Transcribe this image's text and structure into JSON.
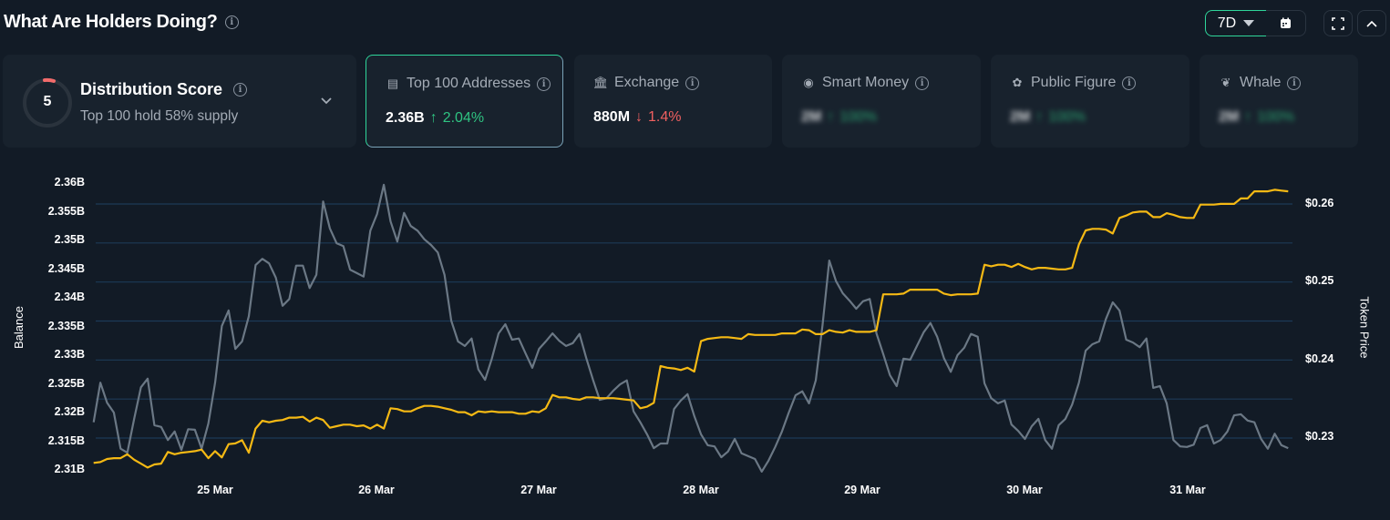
{
  "header": {
    "title": "What Are Holders Doing?",
    "range": "7D"
  },
  "distribution": {
    "score": "5",
    "label": "Distribution Score",
    "subtitle": "Top 100 hold 58% supply",
    "score_color": "#f26b6b"
  },
  "cards": [
    {
      "icon": "money-icon",
      "label": "Top 100 Addresses",
      "value": "2.36B",
      "change": "2.04%",
      "direction": "up",
      "selected": true
    },
    {
      "icon": "bank-icon",
      "label": "Exchange",
      "value": "880M",
      "change": "1.4%",
      "direction": "down"
    },
    {
      "icon": "sunglasses-icon",
      "label": "Smart Money",
      "value": "2M",
      "change": "100%",
      "direction": "up",
      "blurred": true
    },
    {
      "icon": "person-icon",
      "label": "Public Figure",
      "value": "2M",
      "change": "100%",
      "direction": "up",
      "blurred": true
    },
    {
      "icon": "whale-icon",
      "label": "Whale",
      "value": "2M",
      "change": "100%",
      "direction": "up",
      "blurred": true
    }
  ],
  "colors": {
    "accent": "#2fd59a",
    "up": "#2fc482",
    "down": "#f06060",
    "balance_line": "#6b7885",
    "price_line": "#f5b914",
    "grid": "#1c3a57"
  },
  "chart_data": {
    "type": "line",
    "ylabel": "Balance",
    "y2label": "Token Price",
    "ylim": [
      2.31,
      2.36
    ],
    "y2lim": [
      0.23,
      0.26
    ],
    "yticks": [
      "2.36B",
      "2.355B",
      "2.35B",
      "2.345B",
      "2.34B",
      "2.335B",
      "2.33B",
      "2.325B",
      "2.32B",
      "2.315B",
      "2.31B"
    ],
    "y2ticks": [
      "$0.26",
      "$0.25",
      "$0.24",
      "$0.23"
    ],
    "xticks": [
      "25 Mar",
      "26 Mar",
      "27 Mar",
      "28 Mar",
      "29 Mar",
      "30 Mar",
      "31 Mar"
    ],
    "grid": true,
    "series": [
      {
        "name": "Balance",
        "axis": "left"
      },
      {
        "name": "Token Price",
        "axis": "right"
      }
    ],
    "rows": [
      [
        "24 Mar 06:00",
        2.3183,
        0.2267
      ],
      [
        "24 Mar 07:00",
        2.3252,
        0.2268
      ],
      [
        "24 Mar 08:00",
        2.3217,
        0.2272
      ],
      [
        "24 Mar 09:00",
        2.32,
        0.2273
      ],
      [
        "24 Mar 10:00",
        2.3137,
        0.2273
      ],
      [
        "24 Mar 11:00",
        2.313,
        0.2278
      ],
      [
        "24 Mar 12:00",
        2.3189,
        0.2271
      ],
      [
        "24 Mar 13:00",
        2.3244,
        0.2266
      ],
      [
        "24 Mar 14:00",
        2.3259,
        0.2261
      ],
      [
        "24 Mar 15:00",
        2.3178,
        0.2265
      ],
      [
        "24 Mar 16:00",
        2.3175,
        0.2266
      ],
      [
        "24 Mar 17:00",
        2.3152,
        0.2281
      ],
      [
        "24 Mar 18:00",
        2.3167,
        0.2278
      ],
      [
        "24 Mar 19:00",
        2.3135,
        0.228
      ],
      [
        "24 Mar 20:00",
        2.3171,
        0.2281
      ],
      [
        "24 Mar 21:00",
        2.317,
        0.2282
      ],
      [
        "24 Mar 22:00",
        2.3137,
        0.2284
      ],
      [
        "24 Mar 23:00",
        2.3181,
        0.2273
      ],
      [
        "25 Mar 00:00",
        2.3252,
        0.2282
      ],
      [
        "25 Mar 01:00",
        2.3351,
        0.2274
      ],
      [
        "25 Mar 02:00",
        2.3378,
        0.2291
      ],
      [
        "25 Mar 03:00",
        2.3311,
        0.2292
      ],
      [
        "25 Mar 04:00",
        2.3324,
        0.2296
      ],
      [
        "25 Mar 05:00",
        2.3368,
        0.228
      ],
      [
        "25 Mar 06:00",
        2.3457,
        0.2311
      ],
      [
        "25 Mar 07:00",
        2.3468,
        0.2321
      ],
      [
        "25 Mar 08:00",
        2.346,
        0.2319
      ],
      [
        "25 Mar 09:00",
        2.3435,
        0.2321
      ],
      [
        "25 Mar 10:00",
        2.3386,
        0.2322
      ],
      [
        "25 Mar 11:00",
        2.3398,
        0.2325
      ],
      [
        "25 Mar 12:00",
        2.3456,
        0.2325
      ],
      [
        "25 Mar 13:00",
        2.3456,
        0.2326
      ],
      [
        "25 Mar 14:00",
        2.3417,
        0.232
      ],
      [
        "25 Mar 15:00",
        2.344,
        0.2325
      ],
      [
        "25 Mar 16:00",
        2.3568,
        0.2322
      ],
      [
        "25 Mar 17:00",
        2.3521,
        0.2312
      ],
      [
        "25 Mar 18:00",
        2.3495,
        0.2314
      ],
      [
        "25 Mar 19:00",
        2.349,
        0.2316
      ],
      [
        "25 Mar 20:00",
        2.3449,
        0.2316
      ],
      [
        "25 Mar 21:00",
        2.3443,
        0.2314
      ],
      [
        "25 Mar 22:00",
        2.3437,
        0.2315
      ],
      [
        "25 Mar 23:00",
        2.3517,
        0.2311
      ],
      [
        "26 Mar 00:00",
        2.3546,
        0.2316
      ],
      [
        "26 Mar 01:00",
        2.3597,
        0.2311
      ],
      [
        "26 Mar 02:00",
        2.3533,
        0.2337
      ],
      [
        "26 Mar 03:00",
        2.3498,
        0.2336
      ],
      [
        "26 Mar 04:00",
        2.3548,
        0.2333
      ],
      [
        "26 Mar 05:00",
        2.3525,
        0.2333
      ],
      [
        "26 Mar 06:00",
        2.3517,
        0.2337
      ],
      [
        "26 Mar 07:00",
        2.3502,
        0.234
      ],
      [
        "26 Mar 08:00",
        2.3492,
        0.234
      ],
      [
        "26 Mar 09:00",
        2.3479,
        0.2339
      ],
      [
        "26 Mar 10:00",
        2.344,
        0.2337
      ],
      [
        "26 Mar 11:00",
        2.336,
        0.2335
      ],
      [
        "26 Mar 12:00",
        2.3324,
        0.2332
      ],
      [
        "26 Mar 13:00",
        2.3316,
        0.2332
      ],
      [
        "26 Mar 14:00",
        2.3329,
        0.2328
      ],
      [
        "26 Mar 15:00",
        2.3275,
        0.2333
      ],
      [
        "26 Mar 16:00",
        2.3257,
        0.2332
      ],
      [
        "26 Mar 17:00",
        2.3294,
        0.2333
      ],
      [
        "26 Mar 18:00",
        2.3338,
        0.2332
      ],
      [
        "26 Mar 19:00",
        2.3354,
        0.2332
      ],
      [
        "26 Mar 20:00",
        2.3327,
        0.2332
      ],
      [
        "26 Mar 21:00",
        2.3329,
        0.233
      ],
      [
        "26 Mar 22:00",
        2.3303,
        0.233
      ],
      [
        "26 Mar 23:00",
        2.3278,
        0.2333
      ],
      [
        "27 Mar 00:00",
        2.3311,
        0.2332
      ],
      [
        "27 Mar 01:00",
        2.3324,
        0.2337
      ],
      [
        "27 Mar 02:00",
        2.3338,
        0.2354
      ],
      [
        "27 Mar 03:00",
        2.3325,
        0.2351
      ],
      [
        "27 Mar 04:00",
        2.3316,
        0.2351
      ],
      [
        "27 Mar 05:00",
        2.3321,
        0.2349
      ],
      [
        "27 Mar 06:00",
        2.3337,
        0.2348
      ],
      [
        "27 Mar 07:00",
        2.3295,
        0.2351
      ],
      [
        "27 Mar 08:00",
        2.3257,
        0.2351
      ],
      [
        "27 Mar 09:00",
        2.3222,
        0.235
      ],
      [
        "27 Mar 10:00",
        2.3225,
        0.235
      ],
      [
        "27 Mar 11:00",
        2.3238,
        0.235
      ],
      [
        "27 Mar 12:00",
        2.3249,
        0.2349
      ],
      [
        "27 Mar 13:00",
        2.3256,
        0.2348
      ],
      [
        "27 Mar 14:00",
        2.3202,
        0.2347
      ],
      [
        "27 Mar 15:00",
        2.3183,
        0.2337
      ],
      [
        "27 Mar 16:00",
        2.3162,
        0.2339
      ],
      [
        "27 Mar 17:00",
        2.3138,
        0.2344
      ],
      [
        "27 Mar 18:00",
        2.3146,
        0.2391
      ],
      [
        "27 Mar 19:00",
        2.3146,
        0.2389
      ],
      [
        "27 Mar 20:00",
        2.3206,
        0.2388
      ],
      [
        "27 Mar 21:00",
        2.3221,
        0.2386
      ],
      [
        "27 Mar 22:00",
        2.3232,
        0.2389
      ],
      [
        "27 Mar 23:00",
        2.3194,
        0.2384
      ],
      [
        "28 Mar 00:00",
        2.3162,
        0.2423
      ],
      [
        "28 Mar 01:00",
        2.3143,
        0.2426
      ],
      [
        "28 Mar 02:00",
        2.3141,
        0.2427
      ],
      [
        "28 Mar 03:00",
        2.3122,
        0.2428
      ],
      [
        "28 Mar 04:00",
        2.3132,
        0.2428
      ],
      [
        "28 Mar 05:00",
        2.3154,
        0.2427
      ],
      [
        "28 Mar 06:00",
        2.3129,
        0.2426
      ],
      [
        "28 Mar 07:00",
        2.3124,
        0.2432
      ],
      [
        "28 Mar 08:00",
        2.3119,
        0.2431
      ],
      [
        "28 Mar 09:00",
        2.3097,
        0.2431
      ],
      [
        "28 Mar 10:00",
        2.3116,
        0.2431
      ],
      [
        "28 Mar 11:00",
        2.314,
        0.2431
      ],
      [
        "28 Mar 12:00",
        2.3167,
        0.2433
      ],
      [
        "28 Mar 13:00",
        2.32,
        0.2433
      ],
      [
        "28 Mar 14:00",
        2.323,
        0.2433
      ],
      [
        "28 Mar 15:00",
        2.3237,
        0.2438
      ],
      [
        "28 Mar 16:00",
        2.3216,
        0.2437
      ],
      [
        "28 Mar 17:00",
        2.3256,
        0.2432
      ],
      [
        "28 Mar 18:00",
        2.3352,
        0.2432
      ],
      [
        "28 Mar 19:00",
        2.3465,
        0.2437
      ],
      [
        "28 Mar 20:00",
        2.3429,
        0.2435
      ],
      [
        "28 Mar 21:00",
        2.3408,
        0.2434
      ],
      [
        "28 Mar 22:00",
        2.3395,
        0.2437
      ],
      [
        "28 Mar 23:00",
        2.3381,
        0.2435
      ],
      [
        "29 Mar 00:00",
        2.3394,
        0.2435
      ],
      [
        "29 Mar 01:00",
        2.3398,
        0.2435
      ],
      [
        "29 Mar 02:00",
        2.3338,
        0.2437
      ],
      [
        "29 Mar 03:00",
        2.3302,
        0.2483
      ],
      [
        "29 Mar 04:00",
        2.3265,
        0.2483
      ],
      [
        "29 Mar 05:00",
        2.3246,
        0.2483
      ],
      [
        "29 Mar 06:00",
        2.3294,
        0.2484
      ],
      [
        "29 Mar 07:00",
        2.3292,
        0.2489
      ],
      [
        "29 Mar 08:00",
        2.3316,
        0.2489
      ],
      [
        "29 Mar 09:00",
        2.334,
        0.2489
      ],
      [
        "29 Mar 10:00",
        2.3356,
        0.2489
      ],
      [
        "29 Mar 11:00",
        2.3332,
        0.2489
      ],
      [
        "29 Mar 12:00",
        2.3295,
        0.2484
      ],
      [
        "29 Mar 13:00",
        2.3271,
        0.2482
      ],
      [
        "29 Mar 14:00",
        2.33,
        0.2483
      ],
      [
        "29 Mar 15:00",
        2.3313,
        0.2483
      ],
      [
        "29 Mar 16:00",
        2.3337,
        0.2483
      ],
      [
        "29 Mar 17:00",
        2.3332,
        0.2484
      ],
      [
        "29 Mar 18:00",
        2.3251,
        0.2521
      ],
      [
        "29 Mar 19:00",
        2.3225,
        0.2519
      ],
      [
        "29 Mar 20:00",
        2.3216,
        0.2521
      ],
      [
        "29 Mar 21:00",
        2.3221,
        0.2521
      ],
      [
        "29 Mar 22:00",
        2.3179,
        0.2518
      ],
      [
        "29 Mar 23:00",
        2.3168,
        0.2522
      ],
      [
        "30 Mar 00:00",
        2.3154,
        0.2518
      ],
      [
        "30 Mar 01:00",
        2.3176,
        0.2515
      ],
      [
        "30 Mar 02:00",
        2.3189,
        0.2517
      ],
      [
        "30 Mar 03:00",
        2.3152,
        0.2517
      ],
      [
        "30 Mar 04:00",
        2.3137,
        0.2516
      ],
      [
        "30 Mar 05:00",
        2.3178,
        0.2515
      ],
      [
        "30 Mar 06:00",
        2.3189,
        0.2515
      ],
      [
        "30 Mar 07:00",
        2.3214,
        0.2517
      ],
      [
        "30 Mar 08:00",
        2.3252,
        0.2547
      ],
      [
        "30 Mar 09:00",
        2.3308,
        0.2565
      ],
      [
        "30 Mar 10:00",
        2.3319,
        0.2567
      ],
      [
        "30 Mar 11:00",
        2.3324,
        0.2567
      ],
      [
        "30 Mar 12:00",
        2.3363,
        0.2566
      ],
      [
        "30 Mar 13:00",
        2.3392,
        0.2561
      ],
      [
        "30 Mar 14:00",
        2.3378,
        0.2581
      ],
      [
        "30 Mar 15:00",
        2.3327,
        0.2584
      ],
      [
        "30 Mar 16:00",
        2.3322,
        0.2588
      ],
      [
        "30 Mar 17:00",
        2.3314,
        0.2589
      ],
      [
        "30 Mar 18:00",
        2.3329,
        0.2589
      ],
      [
        "30 Mar 19:00",
        2.3243,
        0.2582
      ],
      [
        "30 Mar 20:00",
        2.3246,
        0.2582
      ],
      [
        "30 Mar 21:00",
        2.3216,
        0.2587
      ],
      [
        "30 Mar 22:00",
        2.3152,
        0.2585
      ],
      [
        "30 Mar 23:00",
        2.3141,
        0.2582
      ],
      [
        "31 Mar 00:00",
        2.314,
        0.2581
      ],
      [
        "31 Mar 01:00",
        2.3144,
        0.2581
      ],
      [
        "31 Mar 02:00",
        2.3173,
        0.2598
      ],
      [
        "31 Mar 03:00",
        2.3178,
        0.2598
      ],
      [
        "31 Mar 04:00",
        2.3146,
        0.2598
      ],
      [
        "31 Mar 05:00",
        2.3152,
        0.2599
      ],
      [
        "31 Mar 06:00",
        2.3167,
        0.2599
      ],
      [
        "31 Mar 07:00",
        2.3195,
        0.2599
      ],
      [
        "31 Mar 08:00",
        2.3197,
        0.2606
      ],
      [
        "31 Mar 09:00",
        2.3186,
        0.2606
      ],
      [
        "31 Mar 10:00",
        2.3183,
        0.2615
      ],
      [
        "31 Mar 11:00",
        2.3154,
        0.2615
      ],
      [
        "31 Mar 12:00",
        2.3137,
        0.2615
      ],
      [
        "31 Mar 13:00",
        2.3163,
        0.2617
      ],
      [
        "31 Mar 14:00",
        2.3143,
        0.2616
      ],
      [
        "31 Mar 15:00",
        2.3138,
        0.2615
      ]
    ]
  }
}
